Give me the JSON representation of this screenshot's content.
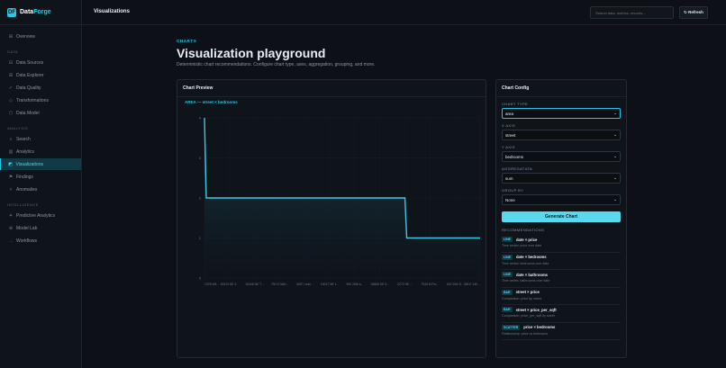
{
  "app": {
    "logo_mark": "DF",
    "name_a": "Data",
    "name_b": "Forge"
  },
  "topbar": {
    "title": "Visualizations",
    "search_placeholder": "Search data, metrics, records...",
    "refresh_label": "↻ Refresh"
  },
  "sidebar": {
    "overview": {
      "icon": "⊞",
      "label": "Overview"
    },
    "sections": [
      {
        "title": "DATA",
        "items": [
          {
            "icon": "⊟",
            "label": "Data Sources"
          },
          {
            "icon": "⊞",
            "label": "Data Explorer"
          },
          {
            "icon": "✓",
            "label": "Data Quality"
          },
          {
            "icon": "◇",
            "label": "Transformations"
          },
          {
            "icon": "⬡",
            "label": "Data Model"
          }
        ]
      },
      {
        "title": "ANALYSIS",
        "items": [
          {
            "icon": "⌕",
            "label": "Search"
          },
          {
            "icon": "▥",
            "label": "Analytics"
          },
          {
            "icon": "◩",
            "label": "Visualizations"
          },
          {
            "icon": "⚑",
            "label": "Findings"
          },
          {
            "icon": "⚡",
            "label": "Anomalies"
          }
        ]
      },
      {
        "title": "INTELLIGENCE",
        "items": [
          {
            "icon": "✦",
            "label": "Predictive Analytics"
          },
          {
            "icon": "⊕",
            "label": "Model Lab"
          },
          {
            "icon": "→",
            "label": "Workflows"
          }
        ]
      }
    ]
  },
  "page": {
    "eyebrow": "CHARTS",
    "title": "Visualization playground",
    "description": "Deterministic chart recommendations. Configure chart type, axes, aggregation, grouping, and more."
  },
  "preview": {
    "title": "Chart Preview"
  },
  "chart_data": {
    "type": "area",
    "title": "AREA — street × bedrooms",
    "x": [
      "1378 Wil...",
      "19024 SE 3...",
      "15408 NE 7...",
      "790 N 34th...",
      "4057 Lean...",
      "19047 NE 1...",
      "900 28th a...",
      "26806 SE 3...",
      "2272 NE ...",
      "7926 N For...",
      "400 20th S...",
      "355 E 140..."
    ],
    "series": [
      {
        "values": [
          4,
          2,
          2,
          2,
          2,
          2,
          2,
          2,
          2,
          1,
          1,
          1
        ]
      }
    ],
    "yticks": [
      "0",
      "1",
      "2",
      "3",
      "4"
    ],
    "ylim": [
      0,
      4
    ],
    "colors": {
      "line": "#3ec7e3"
    }
  },
  "config": {
    "title": "Chart Config",
    "fields": [
      {
        "label": "CHART TYPE",
        "value": "area"
      },
      {
        "label": "X AXIS",
        "value": "street"
      },
      {
        "label": "Y AXIS",
        "value": "bedrooms"
      },
      {
        "label": "AGGREGATION",
        "value": "sum"
      },
      {
        "label": "GROUP BY",
        "value": "None"
      }
    ],
    "generate_label": "Generate Chart",
    "recommendations_title": "RECOMMENDATIONS",
    "recommendations": [
      {
        "badge": "LINE",
        "title": "date × price",
        "desc": "Time series: price over date"
      },
      {
        "badge": "LINE",
        "title": "date × bedrooms",
        "desc": "Time series: bedrooms over date"
      },
      {
        "badge": "LINE",
        "title": "date × bathrooms",
        "desc": "Time series: bathrooms over date"
      },
      {
        "badge": "BAR",
        "title": "street × price",
        "desc": "Comparison: price by street"
      },
      {
        "badge": "BAR",
        "title": "street × price_per_sqft",
        "desc": "Comparison: price_per_sqft by street"
      },
      {
        "badge": "SCATTER",
        "title": "price × bedrooms",
        "desc": "Relationship: price vs bedrooms"
      }
    ]
  }
}
